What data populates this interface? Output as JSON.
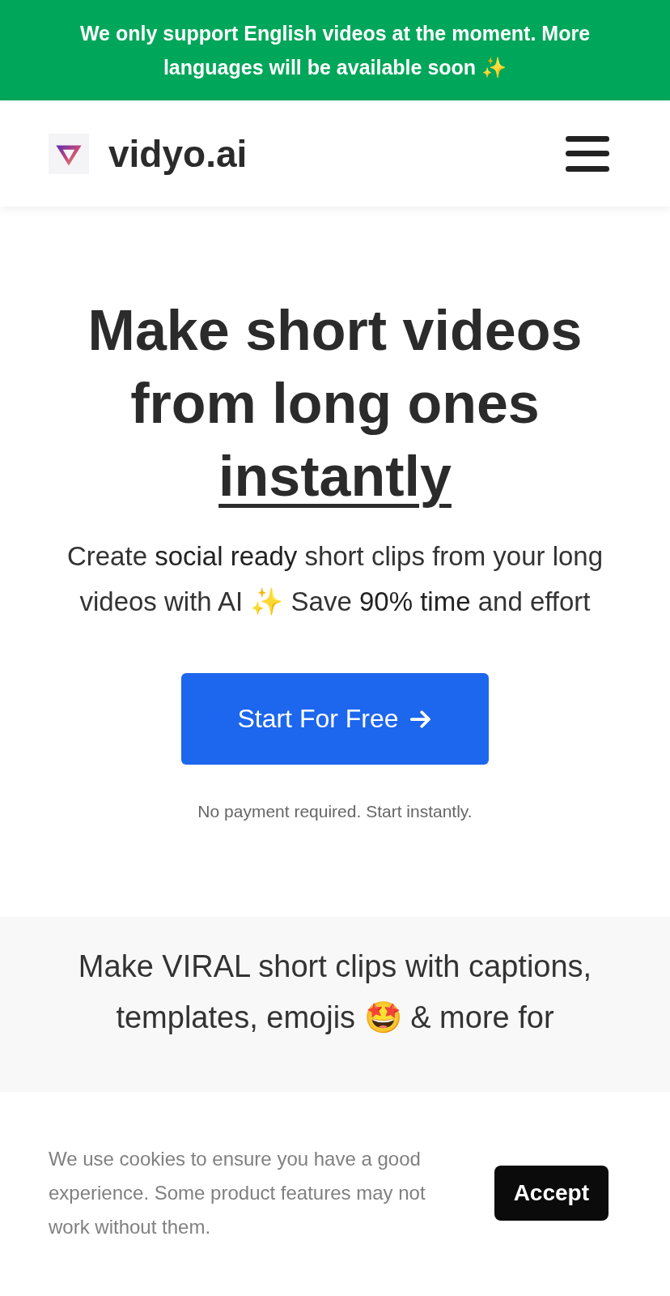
{
  "banner": {
    "text": "We only support English videos at the moment. More languages will be available soon ✨"
  },
  "header": {
    "brand": "vidyo.ai"
  },
  "hero": {
    "heading": "Make short videos from long ones",
    "heading_underlined": "instantly",
    "subtitle": "Create **social ready** short clips from your long videos with AI ✨ Save **90% time** and effort",
    "button": "Start For Free",
    "note": "No payment required. Start instantly."
  },
  "feature": {
    "text": "Make **VIRAL short clips** with captions, templates, emojis 🤩 & more for"
  },
  "cookie": {
    "text": "We use cookies to ensure you have a good experience. Some product features may not work without them.",
    "button": "Accept"
  }
}
